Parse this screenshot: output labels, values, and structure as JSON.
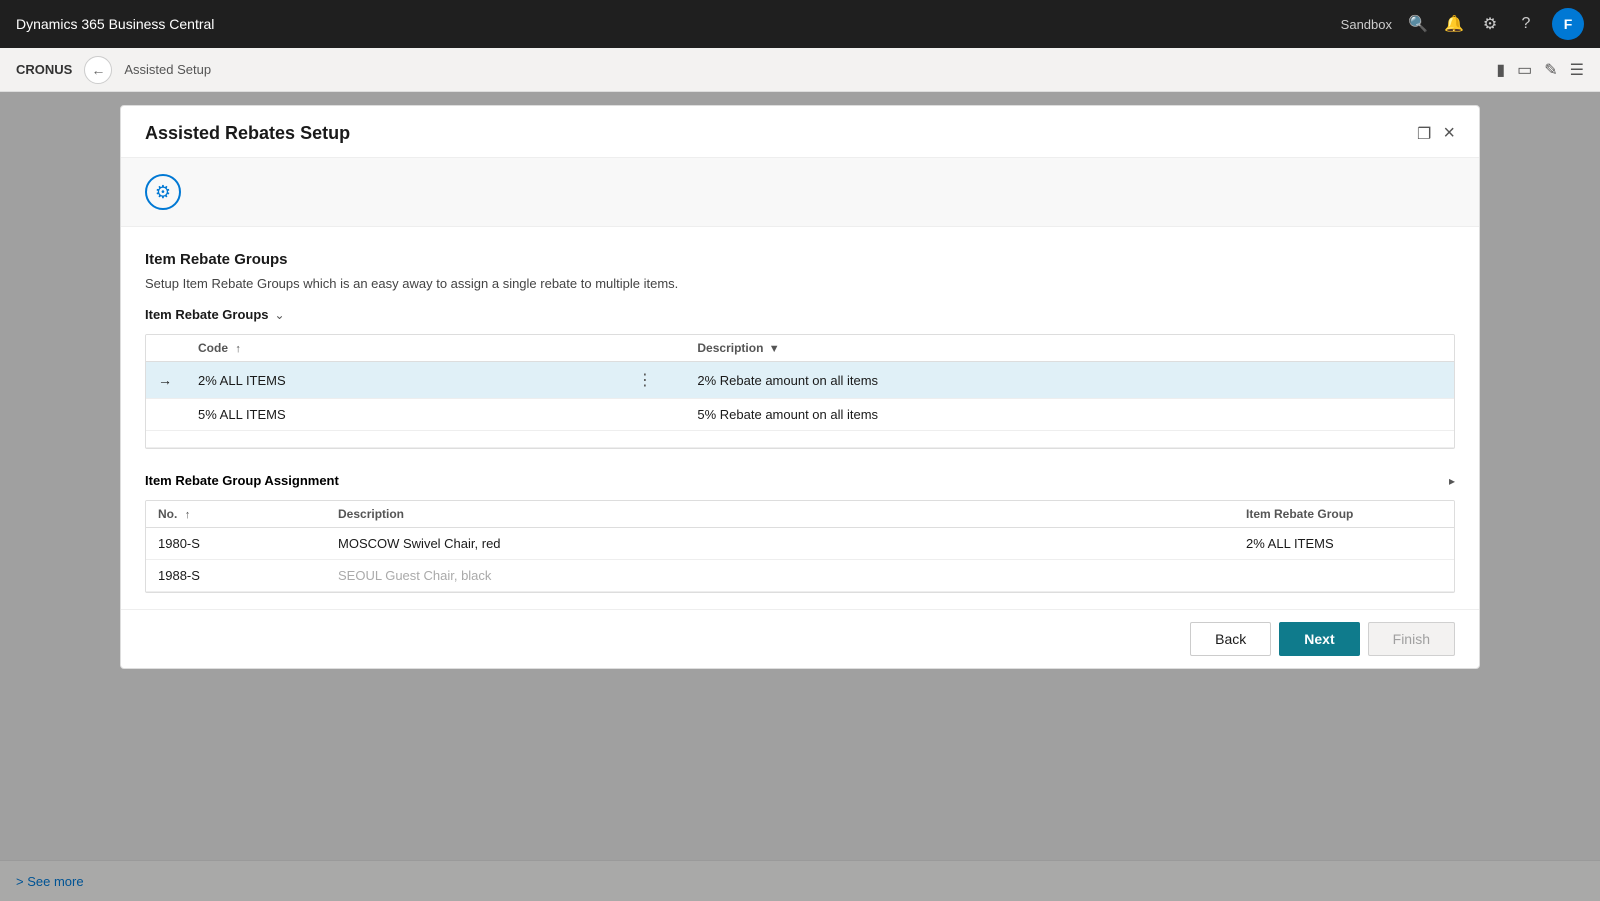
{
  "topbar": {
    "title": "Dynamics 365 Business Central",
    "sandbox_label": "Sandbox",
    "avatar_letter": "F"
  },
  "subnav": {
    "crumb": "CRONUS",
    "page": "Assisted Setup",
    "icons": [
      "tablet-icon",
      "external-link-icon",
      "edit-icon",
      "menu-icon"
    ]
  },
  "modal": {
    "title": "Assisted Rebates Setup",
    "close_label": "×",
    "section1": {
      "title": "Item Rebate Groups",
      "description": "Setup Item Rebate Groups which is an easy away to assign a single rebate to multiple items.",
      "group_header": "Item Rebate Groups",
      "table": {
        "columns": [
          {
            "label": "Code",
            "sort": "↑",
            "key": "code"
          },
          {
            "label": "",
            "key": "actions"
          },
          {
            "label": "Description",
            "filter": true,
            "key": "description"
          }
        ],
        "rows": [
          {
            "code": "2% ALL ITEMS",
            "description": "2% Rebate amount on all items",
            "selected": true
          },
          {
            "code": "5% ALL ITEMS",
            "description": "5% Rebate amount on all items",
            "selected": false
          },
          {
            "code": "",
            "description": "",
            "selected": false
          }
        ]
      }
    },
    "section2": {
      "title": "Item Rebate Group Assignment",
      "table": {
        "columns": [
          {
            "label": "No.",
            "sort": "↑",
            "key": "no"
          },
          {
            "label": "Description",
            "key": "description"
          },
          {
            "label": "Item Rebate Group",
            "key": "group"
          }
        ],
        "rows": [
          {
            "no": "1980-S",
            "description": "MOSCOW Swivel Chair, red",
            "group": "2% ALL ITEMS"
          },
          {
            "no": "1988-S",
            "description": "SEOUL Guest Chair, black",
            "group": ""
          }
        ]
      }
    },
    "footer": {
      "back_label": "Back",
      "next_label": "Next",
      "finish_label": "Finish"
    }
  },
  "see_more": "> See more"
}
